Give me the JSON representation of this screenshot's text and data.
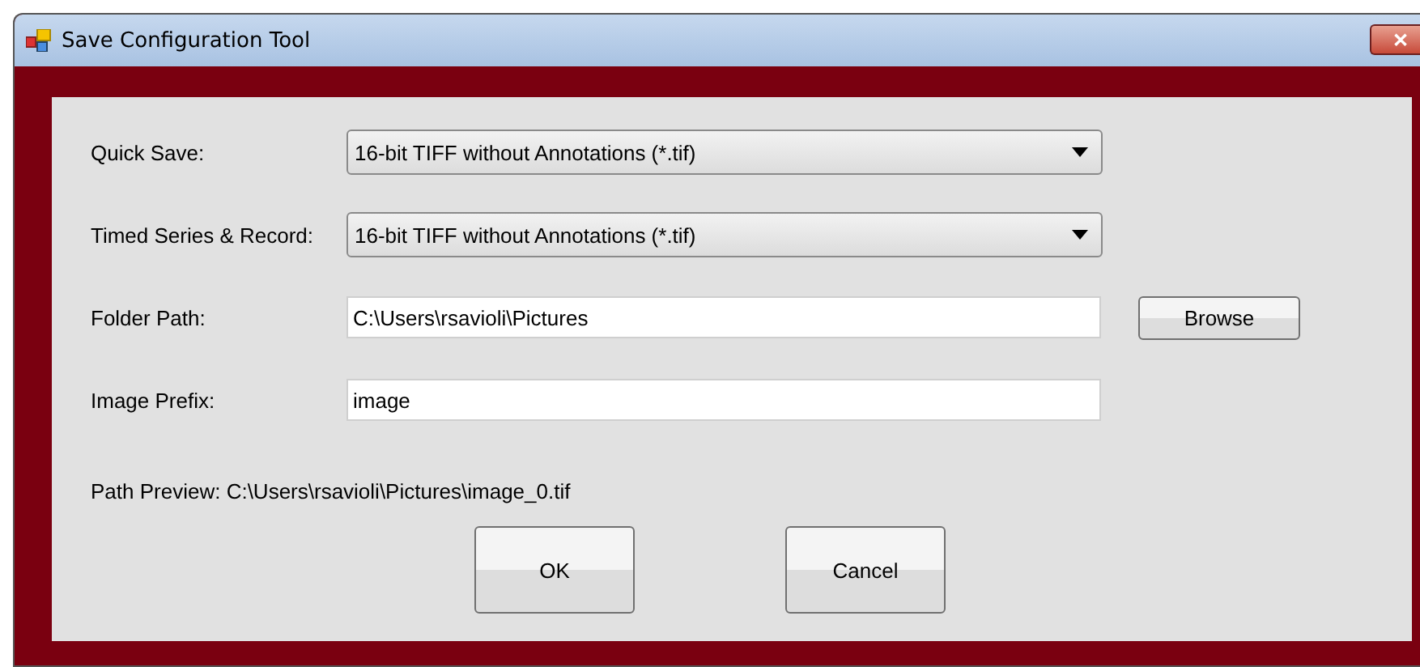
{
  "window": {
    "title": "Save Configuration Tool",
    "close": "✕"
  },
  "fields": [
    {
      "kind": "dropdown",
      "label": "Quick Save:",
      "value": "16-bit TIFF without Annotations (*.tif)"
    },
    {
      "kind": "dropdown",
      "label": "Timed Series & Record:",
      "value": "16-bit TIFF without Annotations (*.tif)"
    },
    {
      "kind": "text",
      "label": "Folder Path:",
      "value": "C:\\Users\\rsavioli\\Pictures",
      "button": "Browse"
    },
    {
      "kind": "text",
      "label": "Image Prefix:",
      "value": "image"
    }
  ],
  "path_preview": "Path Preview: C:\\Users\\rsavioli\\Pictures\\image_0.tif",
  "buttons": [
    "OK",
    "Cancel"
  ]
}
